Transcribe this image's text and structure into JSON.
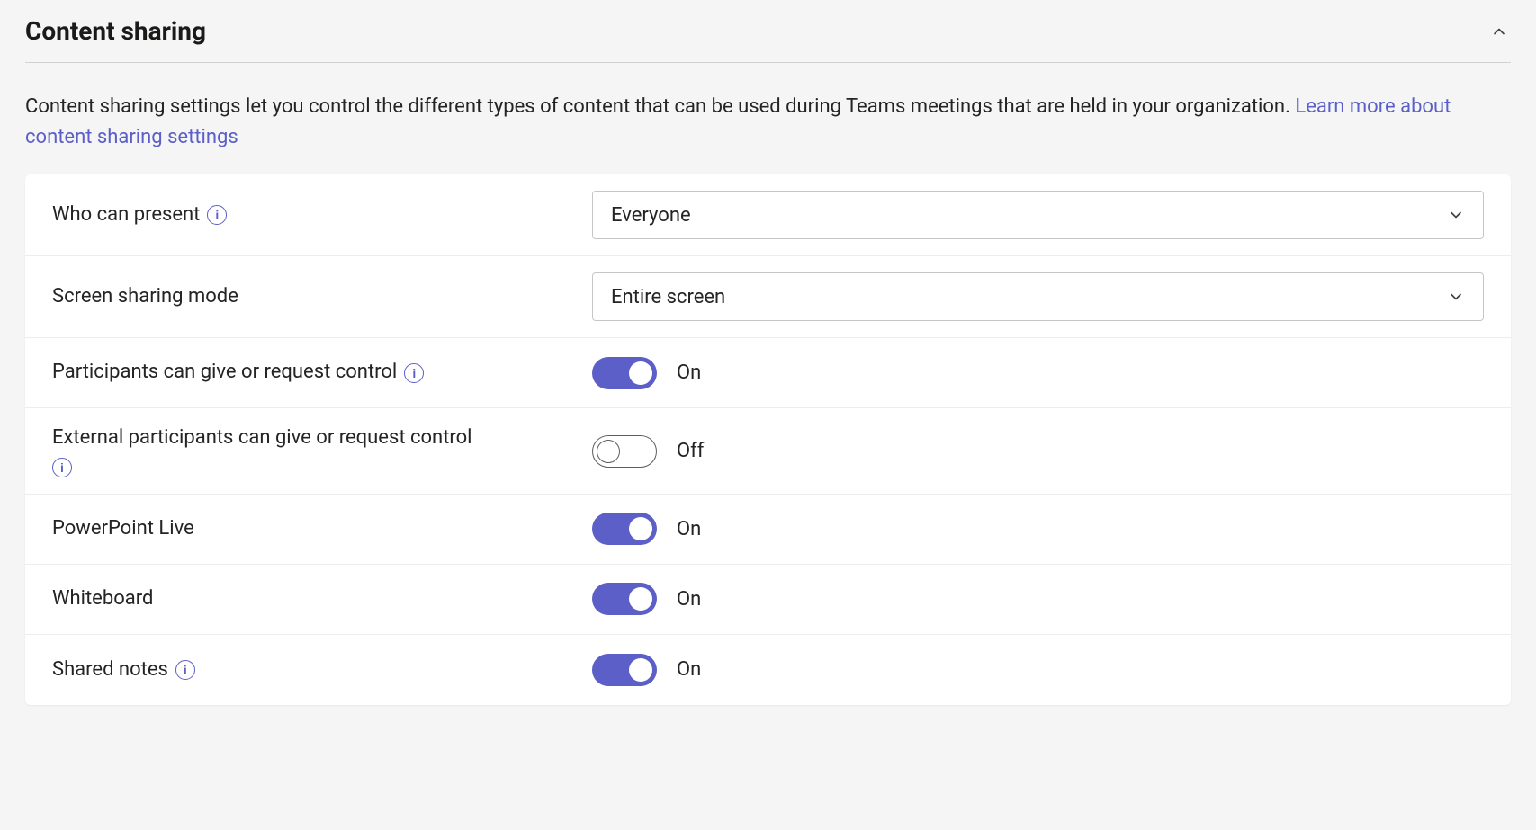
{
  "section": {
    "title": "Content sharing",
    "description_text": "Content sharing settings let you control the different types of content that can be used during Teams meetings that are held in your organization. ",
    "learn_more_text": "Learn more about content sharing settings"
  },
  "labels": {
    "on": "On",
    "off": "Off"
  },
  "rows": {
    "who_can_present": {
      "label": "Who can present",
      "selected": "Everyone"
    },
    "screen_sharing_mode": {
      "label": "Screen sharing mode",
      "selected": "Entire screen"
    },
    "participants_control": {
      "label": "Participants can give or request control"
    },
    "external_participants_control": {
      "label": "External participants can give or request control"
    },
    "powerpoint_live": {
      "label": "PowerPoint Live"
    },
    "whiteboard": {
      "label": "Whiteboard"
    },
    "shared_notes": {
      "label": "Shared notes"
    }
  }
}
